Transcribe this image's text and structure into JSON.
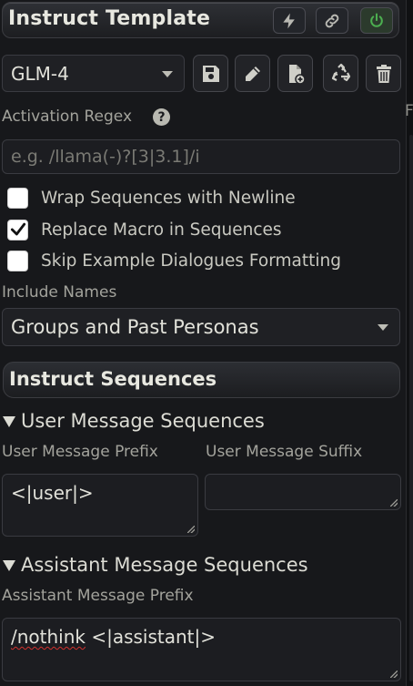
{
  "header": {
    "title": "Instruct Template",
    "buttons": [
      {
        "icon": "bolt-icon",
        "state": "off"
      },
      {
        "icon": "link-icon",
        "state": "off"
      },
      {
        "icon": "power-icon",
        "state": "on",
        "color": "#4caf50"
      }
    ]
  },
  "preset": {
    "selected": "GLM-4",
    "actions": [
      "save-icon",
      "pencil-icon",
      "file-plus-icon",
      "recycle-icon",
      "trash-icon"
    ]
  },
  "activation_regex": {
    "label": "Activation Regex",
    "help": "?",
    "placeholder": "e.g. /llama(-)?[3|3.1]/i",
    "value": ""
  },
  "checkboxes": [
    {
      "label": "Wrap Sequences with Newline",
      "checked": false
    },
    {
      "label": "Replace Macro in Sequences",
      "checked": true
    },
    {
      "label": "Skip Example Dialogues Formatting",
      "checked": false
    }
  ],
  "include_names": {
    "label": "Include Names",
    "selected": "Groups and Past Personas"
  },
  "instruct_sequences": {
    "title": "Instruct Sequences",
    "user": {
      "heading": "User Message Sequences",
      "prefix_label": "User Message Prefix",
      "suffix_label": "User Message Suffix",
      "prefix_value": "<|user|>",
      "suffix_value": ""
    },
    "assistant": {
      "heading": "Assistant Message Sequences",
      "prefix_label": "Assistant Message Prefix",
      "prefix_word": "/nothink",
      "prefix_rest": " <|assistant|>"
    }
  },
  "right_panel": {
    "partial_label": "F"
  }
}
